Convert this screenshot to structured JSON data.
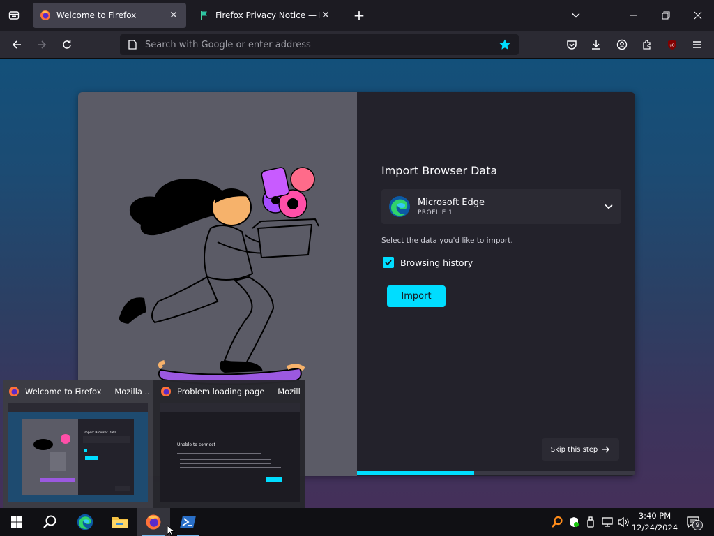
{
  "tabs": [
    {
      "title": "Welcome to Firefox",
      "active": true
    },
    {
      "title": "Firefox Privacy Notice — Mozill",
      "active": false
    }
  ],
  "urlbar": {
    "placeholder": "Search with Google or enter address"
  },
  "import_panel": {
    "title": "Import Browser Data",
    "browser_name": "Microsoft Edge",
    "profile": "PROFILE 1",
    "hint": "Select the data you'd like to import.",
    "checkbox_label": "Browsing history",
    "checkbox_checked": true,
    "import_label": "Import",
    "skip_label": "Skip this step",
    "progress": 0.42
  },
  "thumbnail_preview": {
    "items": [
      {
        "title": "Welcome to Firefox — Mozilla ...",
        "mini": {
          "heading": "Import Browser Data"
        }
      },
      {
        "title": "Problem loading page — Mozill...",
        "mini": {
          "heading": "Unable to connect"
        }
      }
    ]
  },
  "taskbar": {
    "time": "3:40 PM",
    "date": "12/24/2024",
    "notification_count": "9"
  },
  "colors": {
    "accent": "#00ddff",
    "tab_active": "#42414d",
    "panel": "#23222b",
    "toolbar": "#2b2a33"
  }
}
